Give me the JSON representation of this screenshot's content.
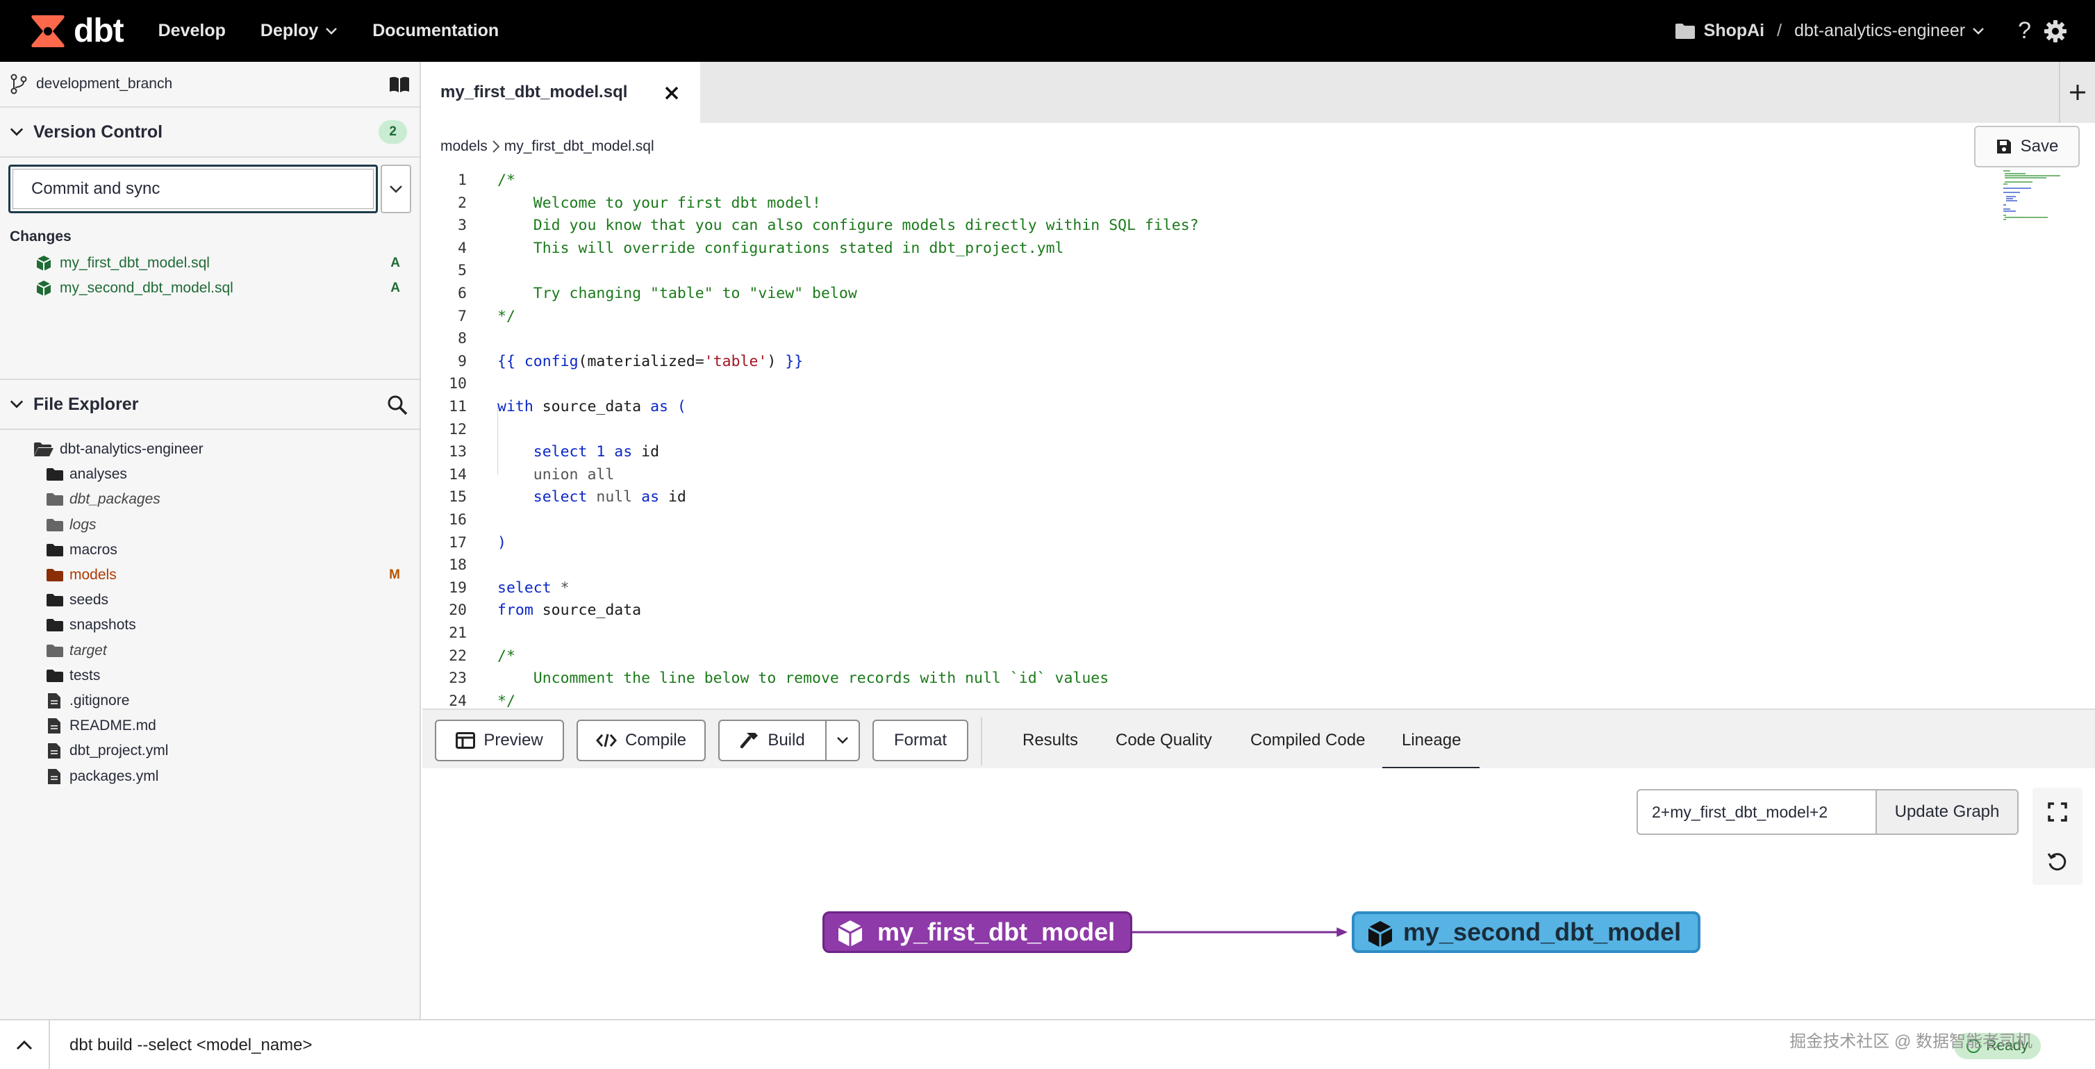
{
  "nav": {
    "logo_text": "dbt",
    "develop": "Develop",
    "deploy": "Deploy",
    "documentation": "Documentation",
    "project": "ShopAi",
    "separator": "/",
    "repo": "dbt-analytics-engineer"
  },
  "sidebar": {
    "branch": "development_branch",
    "version_control": {
      "title": "Version Control",
      "badge": "2",
      "commit_label": "Commit and sync",
      "changes_label": "Changes",
      "changes": [
        {
          "name": "my_first_dbt_model.sql",
          "flag": "A"
        },
        {
          "name": "my_second_dbt_model.sql",
          "flag": "A"
        }
      ]
    },
    "file_explorer": {
      "title": "File Explorer",
      "root": "dbt-analytics-engineer",
      "items": [
        {
          "name": "analyses"
        },
        {
          "name": "dbt_packages"
        },
        {
          "name": "logs"
        },
        {
          "name": "macros"
        },
        {
          "name": "models",
          "flag": "M"
        },
        {
          "name": "seeds"
        },
        {
          "name": "snapshots"
        },
        {
          "name": "target"
        },
        {
          "name": "tests"
        },
        {
          "name": ".gitignore"
        },
        {
          "name": "README.md"
        },
        {
          "name": "dbt_project.yml"
        },
        {
          "name": "packages.yml"
        }
      ]
    }
  },
  "editor": {
    "tab_title": "my_first_dbt_model.sql",
    "breadcrumb": [
      "models",
      "my_first_dbt_model.sql"
    ],
    "save_label": "Save",
    "line_numbers": [
      "1",
      "2",
      "3",
      "4",
      "5",
      "6",
      "7",
      "8",
      "9",
      "10",
      "11",
      "12",
      "13",
      "14",
      "15",
      "16",
      "17",
      "18",
      "19",
      "20",
      "21",
      "22",
      "23",
      "24"
    ],
    "lines": [
      {
        "t": [
          [
            "c-com",
            "/*"
          ]
        ]
      },
      {
        "t": [
          [
            "c-com",
            "    Welcome to your first dbt model!"
          ]
        ]
      },
      {
        "t": [
          [
            "c-com",
            "    Did you know that you can also configure models directly within SQL files?"
          ]
        ]
      },
      {
        "t": [
          [
            "c-com",
            "    This will override configurations stated in dbt_project.yml"
          ]
        ]
      },
      {
        "t": []
      },
      {
        "t": [
          [
            "c-com",
            "    Try changing \"table\" to \"view\" below"
          ]
        ]
      },
      {
        "t": [
          [
            "c-com",
            "*/"
          ]
        ]
      },
      {
        "t": []
      },
      {
        "t": [
          [
            "c-kw",
            "{{ "
          ],
          [
            "c-kw",
            "config"
          ],
          [
            "c-txt",
            "("
          ],
          [
            "c-txt",
            "materialized="
          ],
          [
            "c-str",
            "'table'"
          ],
          [
            "c-txt",
            ") "
          ],
          [
            "c-kw",
            "}}"
          ]
        ]
      },
      {
        "t": []
      },
      {
        "t": [
          [
            "c-kw",
            "with "
          ],
          [
            "c-txt",
            "source_data "
          ],
          [
            "c-kw",
            "as "
          ],
          [
            "c-kw",
            "("
          ]
        ]
      },
      {
        "t": []
      },
      {
        "t": [
          [
            "c-txt",
            "    "
          ],
          [
            "c-kw",
            "select "
          ],
          [
            "c-kw",
            "1 "
          ],
          [
            "c-kw",
            "as "
          ],
          [
            "c-txt",
            "id"
          ]
        ]
      },
      {
        "t": [
          [
            "c-txt",
            "    "
          ],
          [
            "c-gray",
            "union all"
          ]
        ]
      },
      {
        "t": [
          [
            "c-txt",
            "    "
          ],
          [
            "c-kw",
            "select "
          ],
          [
            "c-gray",
            "null "
          ],
          [
            "c-kw",
            "as "
          ],
          [
            "c-txt",
            "id"
          ]
        ]
      },
      {
        "t": []
      },
      {
        "t": [
          [
            "c-kw",
            ")"
          ]
        ]
      },
      {
        "t": []
      },
      {
        "t": [
          [
            "c-kw",
            "select "
          ],
          [
            "c-gray",
            "*"
          ]
        ]
      },
      {
        "t": [
          [
            "c-kw",
            "from "
          ],
          [
            "c-txt",
            "source_data"
          ]
        ]
      },
      {
        "t": []
      },
      {
        "t": [
          [
            "c-com",
            "/*"
          ]
        ]
      },
      {
        "t": [
          [
            "c-com",
            "    Uncomment the line below to remove records with null `id` values"
          ]
        ]
      },
      {
        "t": [
          [
            "c-com",
            "*/"
          ]
        ]
      }
    ]
  },
  "toolbar": {
    "preview": "Preview",
    "compile": "Compile",
    "build": "Build",
    "format": "Format",
    "tabs": [
      "Results",
      "Code Quality",
      "Compiled Code",
      "Lineage"
    ],
    "active_tab": "Lineage"
  },
  "lineage": {
    "selector": "2+my_first_dbt_model+2",
    "update_label": "Update Graph",
    "nodes": [
      "my_first_dbt_model",
      "my_second_dbt_model"
    ]
  },
  "command": {
    "text": "dbt build --select <model_name>",
    "watermark": "掘金技术社区 @ 数据智能老司机",
    "status": "Ready"
  },
  "colors": {
    "nav_bg": "#000000",
    "node_first": "#8e3aa8",
    "node_second": "#56b3e3",
    "added": "#1f6b35",
    "modified": "#b85400",
    "logo": "#ff694b"
  }
}
